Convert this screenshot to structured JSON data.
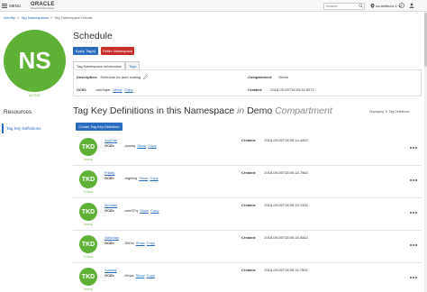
{
  "topbar": {
    "menu_label": "MENU",
    "brand_main": "ORACLE",
    "brand_sub": "Cloud Infrastructure",
    "search_placeholder": "Search",
    "region_label": "us-ashburn-1"
  },
  "breadcrumb": [
    "Identity",
    "Tag Namespaces",
    "Tag Namespace Details"
  ],
  "namespace": {
    "initials": "NS",
    "status": "ACTIVE",
    "title": "Schedule",
    "apply_tags_label": "Apply Tag(s)",
    "retire_label": "Retire Namespace"
  },
  "tabs": [
    "Tag Namespace Information",
    "Tags"
  ],
  "info": {
    "description_label": "Description:",
    "description_value": "Schedule for auto scaling",
    "ocid_label": "OCID:",
    "ocid_value": "...mm3qba",
    "show_label": "Show",
    "copy_label": "Copy",
    "compartment_label": "Compartment:",
    "compartment_value": "Demo",
    "created_label": "Created:",
    "created_value": "2018-09-05T18:04:34.557Z"
  },
  "resources": {
    "title": "Resources",
    "item": "Tag Key Definitions"
  },
  "section": {
    "title_main": "Tag Key Definitions in this Namespace",
    "title_in": "in",
    "title_compartment": "Demo",
    "title_suffix": "Compartment",
    "count": "Displaying 11 Tag Definitions",
    "create_label": "Create Tag Key Definition"
  },
  "row_labels": {
    "ocid": "OCID:",
    "show": "Show",
    "copy": "Copy",
    "created": "Created:",
    "status": "ACTIVE",
    "initials": "TKD"
  },
  "tag_keys": [
    {
      "name": "AnyDay",
      "ocid": "...zpusiq",
      "created": "2018-09-05T18:05:14.426Z"
    },
    {
      "name": "Friday",
      "ocid": "...mgebrq",
      "created": "2018-09-05T18:05:18.756Z"
    },
    {
      "name": "Monday",
      "ocid": "...mmf37q",
      "created": "2018-09-05T18:05:13.743Z"
    },
    {
      "name": "Saturday",
      "ocid": "...f343a",
      "created": "2018-09-05T18:05:16.534Z"
    },
    {
      "name": "Sunday",
      "ocid": "...f4ryia",
      "created": "2018-09-05T18:05:16.750Z"
    }
  ]
}
